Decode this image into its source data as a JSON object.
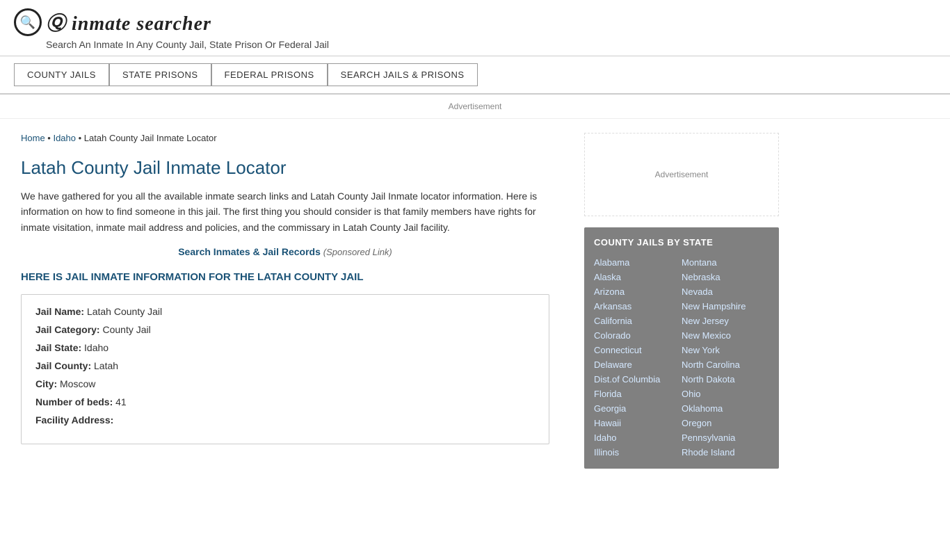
{
  "header": {
    "logo_icon": "🔍",
    "logo_text_part1": "inmate",
    "logo_text_part2": "searcher",
    "tagline": "Search An Inmate In Any County Jail, State Prison Or Federal Jail"
  },
  "nav": {
    "items": [
      {
        "label": "COUNTY JAILS",
        "id": "county-jails"
      },
      {
        "label": "STATE PRISONS",
        "id": "state-prisons"
      },
      {
        "label": "FEDERAL PRISONS",
        "id": "federal-prisons"
      },
      {
        "label": "SEARCH JAILS & PRISONS",
        "id": "search-jails"
      }
    ]
  },
  "ad_label": "Advertisement",
  "breadcrumb": {
    "home": "Home",
    "state": "Idaho",
    "current": "Latah County Jail Inmate Locator"
  },
  "page_title": "Latah County Jail Inmate Locator",
  "description": "We have gathered for you all the available inmate search links and Latah County Jail Inmate locator information. Here is information on how to find someone in this jail. The first thing you should consider is that family members have rights for inmate visitation, inmate mail address and policies, and the commissary in Latah County Jail facility.",
  "sponsored": {
    "link_text": "Search Inmates & Jail Records",
    "note": "(Sponsored Link)"
  },
  "info_heading": "HERE IS JAIL INMATE INFORMATION FOR THE LATAH COUNTY JAIL",
  "jail_info": {
    "name_label": "Jail Name:",
    "name_value": "Latah County Jail",
    "category_label": "Jail Category:",
    "category_value": "County Jail",
    "state_label": "Jail State:",
    "state_value": "Idaho",
    "county_label": "Jail County:",
    "county_value": "Latah",
    "city_label": "City:",
    "city_value": "Moscow",
    "beds_label": "Number of beds:",
    "beds_value": "41",
    "address_label": "Facility Address:"
  },
  "sidebar": {
    "ad_label": "Advertisement",
    "state_box_title": "COUNTY JAILS BY STATE",
    "states_col1": [
      "Alabama",
      "Alaska",
      "Arizona",
      "Arkansas",
      "California",
      "Colorado",
      "Connecticut",
      "Delaware",
      "Dist.of Columbia",
      "Florida",
      "Georgia",
      "Hawaii",
      "Idaho",
      "Illinois"
    ],
    "states_col2": [
      "Montana",
      "Nebraska",
      "Nevada",
      "New Hampshire",
      "New Jersey",
      "New Mexico",
      "New York",
      "North Carolina",
      "North Dakota",
      "Ohio",
      "Oklahoma",
      "Oregon",
      "Pennsylvania",
      "Rhode Island"
    ]
  }
}
